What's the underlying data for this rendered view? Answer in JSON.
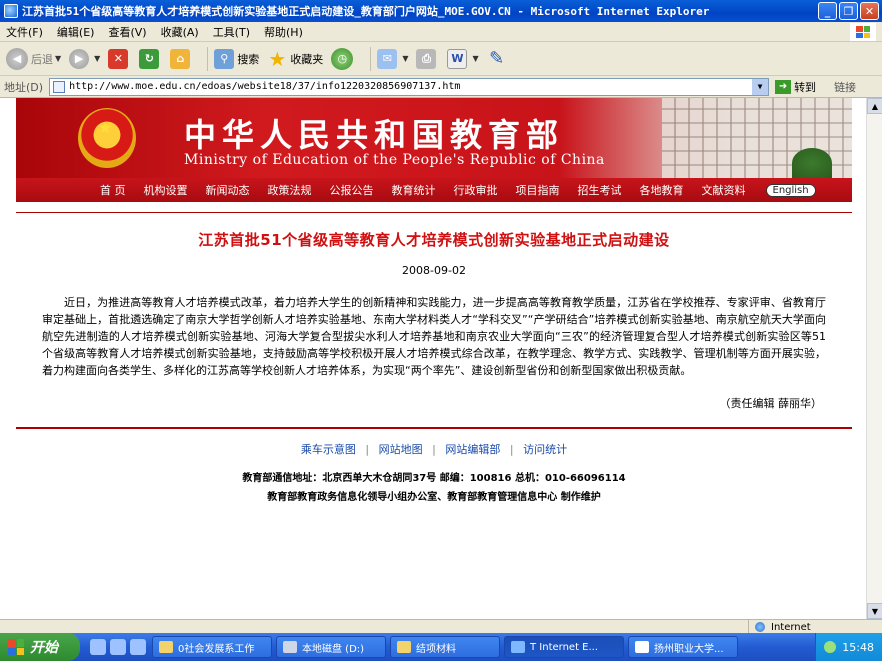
{
  "window": {
    "title": "江苏首批51个省级高等教育人才培养模式创新实验基地正式启动建设_教育部门户网站_MOE.GOV.CN - Microsoft Internet Explorer",
    "min": "_",
    "max": "❐",
    "close": "✕"
  },
  "menu": [
    "文件(F)",
    "编辑(E)",
    "查看(V)",
    "收藏(A)",
    "工具(T)",
    "帮助(H)"
  ],
  "toolbar": {
    "back": "后退",
    "search": "搜索",
    "favorites": "收藏夹"
  },
  "address": {
    "label": "地址(D)",
    "url": "http://www.moe.edu.cn/edoas/website18/37/info1220320856907137.htm",
    "go": "转到",
    "links": "链接"
  },
  "site": {
    "cn_name": "中华人民共和国教育部",
    "en_name": "Ministry of Education of the People's Republic of China"
  },
  "nav": [
    "首  页",
    "机构设置",
    "新闻动态",
    "政策法规",
    "公报公告",
    "教育统计",
    "行政审批",
    "项目指南",
    "招生考试",
    "各地教育",
    "文献资料"
  ],
  "nav_english": "English",
  "article": {
    "headline": "江苏首批51个省级高等教育人才培养模式创新实验基地正式启动建设",
    "date": "2008-09-02",
    "body": "近日，为推进高等教育人才培养模式改革，着力培养大学生的创新精神和实践能力，进一步提高高等教育教学质量，江苏省在学校推荐、专家评审、省教育厅审定基础上，首批遴选确定了南京大学哲学创新人才培养实验基地、东南大学材料类人才“学科交叉”“产学研结合”培养模式创新实验基地、南京航空航天大学面向航空先进制造的人才培养模式创新实验基地、河海大学复合型拔尖水利人才培养基地和南京农业大学面向“三农”的经济管理复合型人才培养模式创新实验区等51个省级高等教育人才培养模式创新实验基地，支持鼓励高等学校积极开展人才培养模式综合改革，在教学理念、教学方式、实践教学、管理机制等方面开展实验，着力构建面向各类学生、多样化的江苏高等学校创新人才培养体系，为实现“两个率先”、建设创新型省份和创新型国家做出积极贡献。",
    "editor": "（责任编辑  薛丽华）"
  },
  "footer": {
    "links": [
      "乘车示意图",
      "网站地图",
      "网站编辑部",
      "访问统计"
    ],
    "sep": "|",
    "address": "教育部通信地址：北京西单大木仓胡同37号    邮编：100816    总机：010-66096114",
    "maintainer": "教育部教育政务信息化领导小组办公室、教育部教育管理信息中心 制作维护"
  },
  "status": {
    "zone": "Internet"
  },
  "taskbar": {
    "start": "开始",
    "tasks": [
      "0社会发展系工作",
      "本地磁盘 (D:)",
      "结项材料",
      "T Internet E...",
      "扬州职业大学..."
    ],
    "clock": "15:48"
  }
}
